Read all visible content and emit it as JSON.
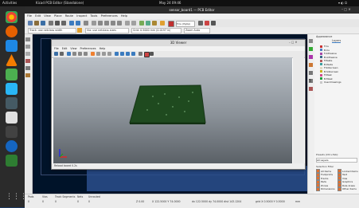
{
  "topbar": {
    "activities": "Activities",
    "app_name": "Kicad PCB Editor (Standalone)",
    "clock": "May 24 09:46"
  },
  "window": {
    "title": "sensor_board1 — PCB Editor"
  },
  "menu": [
    "File",
    "Edit",
    "View",
    "Place",
    "Route",
    "Inspect",
    "Tools",
    "Preferences",
    "Help"
  ],
  "toolbar2": {
    "track": "Track: use netclass width",
    "via": "Via: use netclass sizes",
    "grid": "Grid: 0.5000 mm (0.0197 in)",
    "zoom": "Zoom Auto"
  },
  "viewer3d": {
    "title": "3D Viewer",
    "menu": [
      "File",
      "Edit",
      "View",
      "Preferences",
      "Help"
    ],
    "status": "Reload board 0.2s"
  },
  "right_panel": {
    "title": "Appearance",
    "tab": "Layers",
    "layers": [
      {
        "name": "F.Cu",
        "color": "#c83232"
      },
      {
        "name": "B.Cu",
        "color": "#4d7fc4"
      },
      {
        "name": "F.Adhesive",
        "color": "#a74aa7"
      },
      {
        "name": "B.Adhesive",
        "color": "#3a6b8a"
      },
      {
        "name": "F.Paste",
        "color": "#b45c5c"
      },
      {
        "name": "B.Paste",
        "color": "#3ca0a0"
      },
      {
        "name": "F.Silkscreen",
        "color": "#e0d8c0"
      },
      {
        "name": "B.Silkscreen",
        "color": "#c8b020"
      },
      {
        "name": "F.Mask",
        "color": "#d04b8e"
      },
      {
        "name": "B.Mask",
        "color": "#20a040"
      },
      {
        "name": "User.Drawings",
        "color": "#c8c8c8"
      }
    ],
    "presets_label": "Presets (Ctrl+Tab):",
    "preset_value": "All Layers",
    "selection_filter_title": "Selection Filter",
    "filters": [
      "All items",
      "Locked items",
      "Footprints",
      "Text",
      "Tracks",
      "Vias",
      "Pads",
      "Graphics",
      "Zones",
      "Rule Areas",
      "Dimensions",
      "Other items"
    ]
  },
  "status": {
    "col1_label": "Pads",
    "col1_value": "0",
    "col2_label": "Vias",
    "col2_value": "0",
    "col3_label": "Track Segments",
    "col3_value": "0",
    "col4_label": "Nets",
    "col4_value": "0",
    "col5_label": "Unrouted",
    "col5_value": "0",
    "zoom": "Z 0.00",
    "xy": "X 122.5000  Y 74.0000",
    "dxdy": "dx 122.5000  dy 74.0000  dist 143.1204",
    "grid": "grid X 0.5000  Y 0.5000",
    "units": "mm"
  },
  "colors": {
    "board": "#1e4a1e",
    "canvas": "#001329",
    "accent": "#d6a040"
  }
}
